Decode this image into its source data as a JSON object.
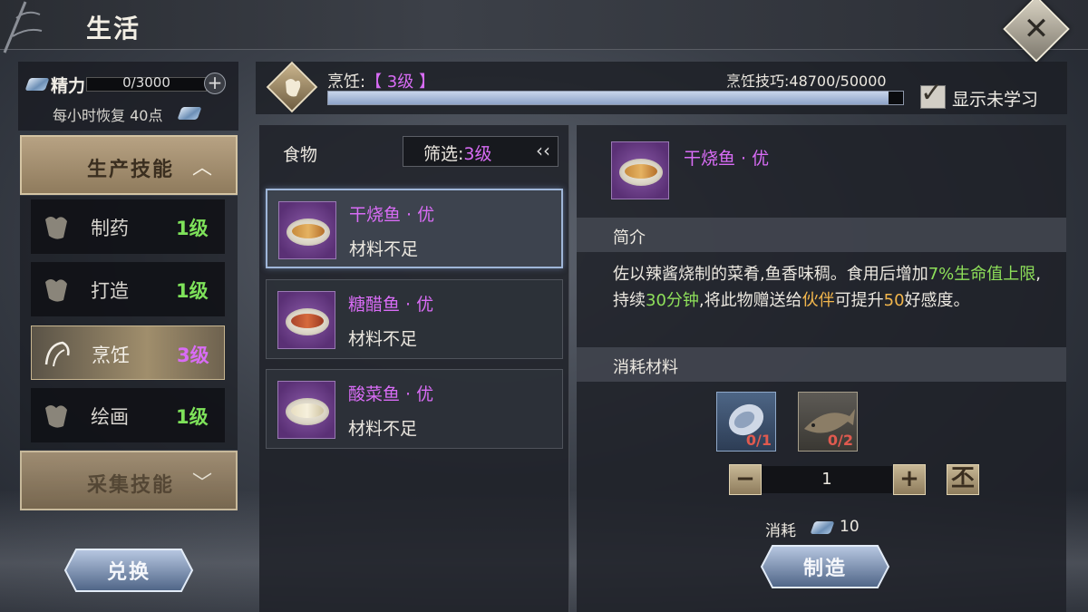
{
  "header": {
    "title": "生活"
  },
  "stamina": {
    "label": "精力",
    "value": "0/3000",
    "recover_text": "每小时恢复 40点"
  },
  "categories": {
    "production": {
      "label": "生产技能"
    },
    "gathering": {
      "label": "采集技能"
    }
  },
  "skills": [
    {
      "name": "制药",
      "level": "1级"
    },
    {
      "name": "打造",
      "level": "1级"
    },
    {
      "name": "烹饪",
      "level": "3级"
    },
    {
      "name": "绘画",
      "level": "1级"
    }
  ],
  "exchange_button": "兑换",
  "skill_bar": {
    "title_prefix": "烹饪:",
    "level": "【 3级 】",
    "skill_text": "烹饪技巧:48700/50000",
    "progress_fraction": 0.974,
    "show_unlearned_label": "显示未学习"
  },
  "food_panel": {
    "tab_label": "食物",
    "filter_label": "筛选:",
    "filter_value": "3级",
    "filter_arrow": "‹‹",
    "recipes": [
      {
        "name": "干烧鱼 · 优",
        "status": "材料不足"
      },
      {
        "name": "糖醋鱼 · 优",
        "status": "材料不足"
      },
      {
        "name": "酸菜鱼 · 优",
        "status": "材料不足"
      }
    ]
  },
  "detail": {
    "name": "干烧鱼 · 优",
    "intro_title": "简介",
    "desc_parts": {
      "p1": "佐以辣酱烧制的菜肴,鱼香味稠。食用后增加",
      "p2": "7%生命值上限",
      "p3": ",持续",
      "p4": "30分钟",
      "p5": ",将此物赠送给",
      "p6": "伙伴",
      "p7": "可提升",
      "p8": "50",
      "p9": "好感度。"
    },
    "materials_title": "消耗材料",
    "materials": [
      {
        "count": "0/1"
      },
      {
        "count": "0/2"
      }
    ],
    "quantity": "1",
    "minus": "−",
    "plus": "+",
    "max": "丕",
    "consume_label": "消耗",
    "consume_value": "10",
    "make_button": "制造"
  },
  "colors": {
    "purple": "#d86cf5",
    "green": "#8ee05a",
    "orange": "#f2b64c",
    "red": "#e05a4f",
    "gold": "#b7a283"
  }
}
